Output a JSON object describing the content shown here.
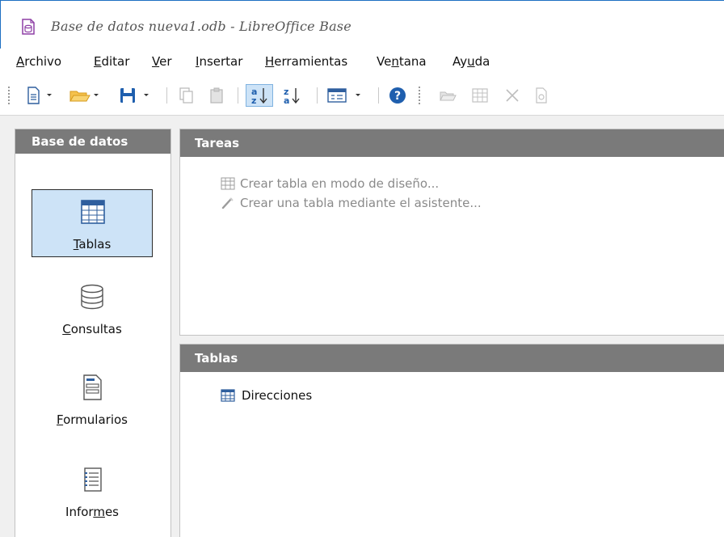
{
  "window": {
    "title": "Base de datos nueva1.odb - LibreOffice Base"
  },
  "menu": [
    {
      "label": "Archivo",
      "mnemonic": "A",
      "rest": "rchivo"
    },
    {
      "label": "Editar",
      "mnemonic": "E",
      "rest": "ditar"
    },
    {
      "label": "Ver",
      "mnemonic": "V",
      "rest": "er"
    },
    {
      "label": "Insertar",
      "mnemonic": "I",
      "rest": "nsertar"
    },
    {
      "label": "Herramientas",
      "mnemonic": "H",
      "rest": "erramientas"
    },
    {
      "label": "Ventana",
      "pre": "Ve",
      "mnemonic": "n",
      "rest": "tana"
    },
    {
      "label": "Ayuda",
      "pre": "Ay",
      "mnemonic": "u",
      "rest": "da"
    }
  ],
  "toolbar": {
    "icons": [
      "new-document-icon",
      "open-folder-icon",
      "save-icon",
      "copy-icon",
      "paste-icon",
      "sort-ascending-icon",
      "sort-descending-icon",
      "form-view-icon",
      "help-icon",
      "open-object-icon",
      "edit-table-icon",
      "delete-icon",
      "rename-icon"
    ]
  },
  "sidebar": {
    "header": "Base de datos",
    "items": [
      {
        "label": "Tablas",
        "mnemonic": "T",
        "rest": "ablas",
        "icon": "table-icon",
        "selected": true
      },
      {
        "label": "Consultas",
        "mnemonic": "C",
        "rest": "onsultas",
        "icon": "database-icon",
        "selected": false
      },
      {
        "label": "Formularios",
        "mnemonic": "F",
        "rest": "ormularios",
        "icon": "form-icon",
        "selected": false
      },
      {
        "label": "Informes",
        "pre": "Infor",
        "mnemonic": "m",
        "rest": "es",
        "icon": "report-icon",
        "selected": false
      }
    ]
  },
  "tasks": {
    "header": "Tareas",
    "items": [
      {
        "label": "Crear tabla en modo de diseño...",
        "icon": "table-design-icon"
      },
      {
        "label": "Crear una tabla mediante el asistente...",
        "icon": "wizard-icon"
      }
    ]
  },
  "tables": {
    "header": "Tablas",
    "items": [
      {
        "label": "Direcciones",
        "icon": "table-icon"
      }
    ]
  },
  "colors": {
    "accent": "#1d6fc2",
    "panel_header": "#7a7a7a",
    "selection": "#cde3f7"
  }
}
